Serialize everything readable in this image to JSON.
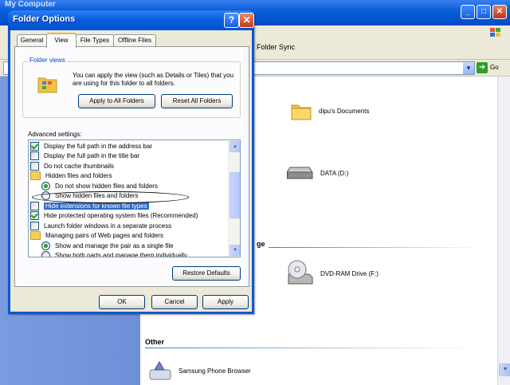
{
  "background_window": {
    "title": "My Computer",
    "toolbar_folder_sync": "Folder Sync",
    "go_label": "Go",
    "items": [
      {
        "label": "dipu's Documents",
        "icon": "folder-icon"
      },
      {
        "label": "DATA (D:)",
        "icon": "hard-drive-icon"
      },
      {
        "label": "DVD-RAM Drive (F:)",
        "icon": "dvd-drive-icon"
      },
      {
        "label": "Samsung Phone Browser",
        "icon": "phone-browser-icon"
      }
    ],
    "partial_group_suffix": "ge",
    "group_other": "Other"
  },
  "dialog": {
    "title": "Folder Options",
    "help_glyph": "?",
    "close_glyph": "✕",
    "tabs": [
      "General",
      "View",
      "File Types",
      "Offline Files"
    ],
    "active_tab": "View",
    "folder_views": {
      "legend": "Folder views",
      "description": "You can apply the view (such as Details or Tiles) that you are using for this folder to all folders.",
      "apply_button": "Apply to All Folders",
      "reset_button": "Reset All Folders"
    },
    "advanced_label": "Advanced settings:",
    "advanced_rows": [
      {
        "type": "checkbox",
        "checked": true,
        "text": "Display the full path in the address bar",
        "indent": 0
      },
      {
        "type": "checkbox",
        "checked": false,
        "text": "Display the full path in the title bar",
        "indent": 0
      },
      {
        "type": "checkbox",
        "checked": false,
        "text": "Do not cache thumbnails",
        "indent": 0
      },
      {
        "type": "folder",
        "text": "Hidden files and folders",
        "indent": 0
      },
      {
        "type": "radio",
        "checked": true,
        "text": "Do not show hidden files and folders",
        "indent": 1
      },
      {
        "type": "radio",
        "checked": false,
        "text": "Show hidden files and folders",
        "indent": 1
      },
      {
        "type": "checkbox",
        "checked": false,
        "text": "Hide extensions for known file types",
        "indent": 0,
        "selected": true
      },
      {
        "type": "checkbox",
        "checked": true,
        "text": "Hide protected operating system files (Recommended)",
        "indent": 0
      },
      {
        "type": "checkbox",
        "checked": false,
        "text": "Launch folder windows in a separate process",
        "indent": 0
      },
      {
        "type": "folder",
        "text": "Managing pairs of Web pages and folders",
        "indent": 0
      },
      {
        "type": "radio",
        "checked": true,
        "text": "Show and manage the pair as a single file",
        "indent": 1
      },
      {
        "type": "radio",
        "checked": false,
        "text": "Show both parts and manage them individually",
        "indent": 1
      }
    ],
    "restore_defaults": "Restore Defaults",
    "ok": "OK",
    "cancel": "Cancel",
    "apply": "Apply"
  },
  "colors": {
    "title_bar": "#0a5fdc",
    "dialog_face": "#ece9d8",
    "selection": "#316ac5",
    "left_pane": "#7a9be0"
  }
}
